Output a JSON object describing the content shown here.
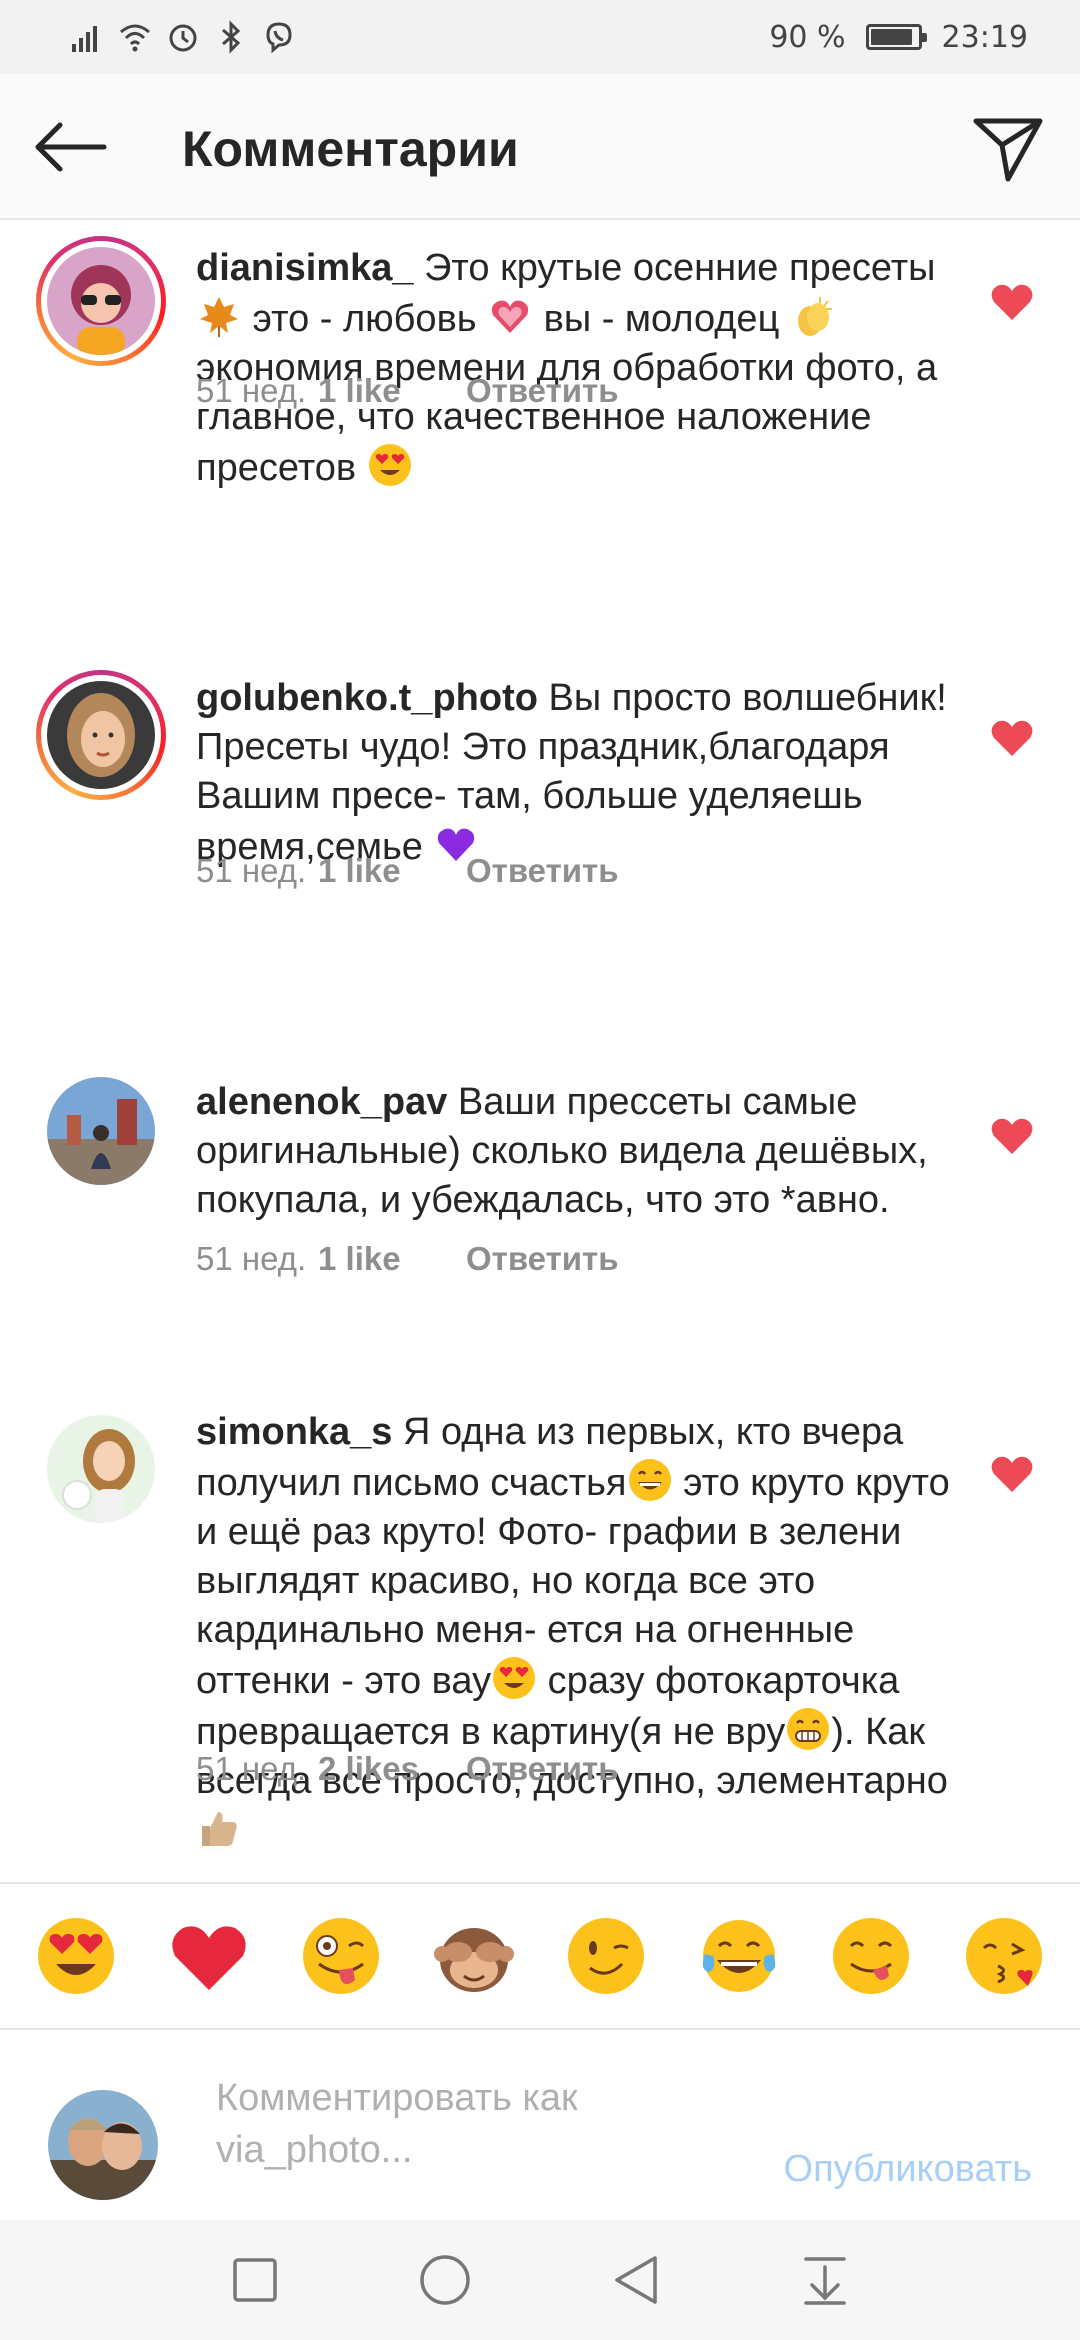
{
  "status_bar": {
    "battery_percent_text": "90 %",
    "battery_level": 0.9,
    "time": "23:19",
    "icons": [
      "signal-icon",
      "wifi-icon",
      "alarm-icon",
      "bluetooth-icon",
      "viber-icon"
    ]
  },
  "header": {
    "title": "Комментарии",
    "back_icon": "arrow-left-icon",
    "share_icon": "paper-plane-icon"
  },
  "comments": [
    {
      "username": "dianisimka_",
      "text_segments": [
        " Это крутые осенние пресеты ",
        "maple-leaf-emoji",
        " это - любовь ",
        "sparkling-heart-emoji",
        " вы - молодец ",
        "clapping-hands-emoji",
        "  экономия времени для обработки фото, а главное, что качественное наложение пресетов ",
        "heart-eyes-emoji"
      ],
      "time": "51 нед.",
      "likes": "1 like",
      "reply": "Ответить",
      "has_story_ring": true,
      "liked": true
    },
    {
      "username": "golubenko.t_photo",
      "text_segments": [
        " Вы просто волшебник! Пресеты чудо! Это праздник,благодаря Вашим пресе- там,  больше уделяешь время,семье ",
        "purple-heart-emoji"
      ],
      "time": "51 нед.",
      "likes": "1 like",
      "reply": "Ответить",
      "has_story_ring": true,
      "liked": true
    },
    {
      "username": "alenenok_pav",
      "text_segments": [
        " Ваши прессеты самые оригинальные) сколько видела дешёвых, покупала, и убеждалась, что это *авно."
      ],
      "time": "51 нед.",
      "likes": "1 like",
      "reply": "Ответить",
      "has_story_ring": false,
      "liked": true
    },
    {
      "username": "simonka_s",
      "text_segments": [
        " Я одна из первых, кто вчера получил письмо счастья",
        "grinning-emoji",
        " это круто круто и ещё раз круто! Фото- графии в зелени выглядят красиво, но когда все это кардинально меня- ется на огненные оттенки - это вау",
        "heart-eyes-emoji",
        " сразу фотокарточка превращается в картину(я не вру",
        "grimacing-emoji",
        "). Как всегда все просто, доступно, элементарно",
        "thumbs-up-emoji"
      ],
      "time": "51 нед.",
      "likes": "2 likes",
      "reply": "Ответить",
      "has_story_ring": false,
      "liked": true
    }
  ],
  "emoji_bar": [
    "heart-eyes-emoji",
    "red-heart-emoji",
    "zany-face-emoji",
    "see-no-evil-monkey-emoji",
    "winking-face-emoji",
    "tears-of-joy-emoji",
    "yum-face-emoji",
    "kissing-heart-emoji"
  ],
  "composer": {
    "placeholder": "Комментировать как via_photo...",
    "value": "",
    "publish_label": "Опубликовать"
  },
  "navbar": [
    "square-icon",
    "circle-icon",
    "triangle-back-icon",
    "notification-pull-icon"
  ],
  "colors": {
    "like_red": "#ed4956",
    "publish_blue": "#a8cff5",
    "meta_gray": "#8e8e8e"
  }
}
